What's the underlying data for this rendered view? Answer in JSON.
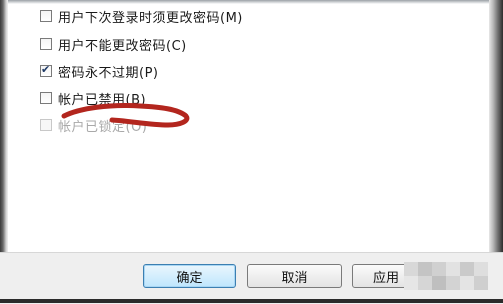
{
  "options": [
    {
      "label": "用户下次登录时须更改密码(M)",
      "checked": false,
      "disabled": false
    },
    {
      "label": "用户不能更改密码(C)",
      "checked": false,
      "disabled": false
    },
    {
      "label": "密码永不过期(P)",
      "checked": true,
      "disabled": false
    },
    {
      "label": "帐户已禁用(B)",
      "checked": false,
      "disabled": false
    },
    {
      "label": "帐户已锁定(O)",
      "checked": false,
      "disabled": true
    }
  ],
  "buttons": {
    "ok": "确定",
    "cancel": "取消",
    "apply": "应用"
  },
  "colors": {
    "annotation": "#b3261e",
    "default_button": "#3c7fb1"
  }
}
